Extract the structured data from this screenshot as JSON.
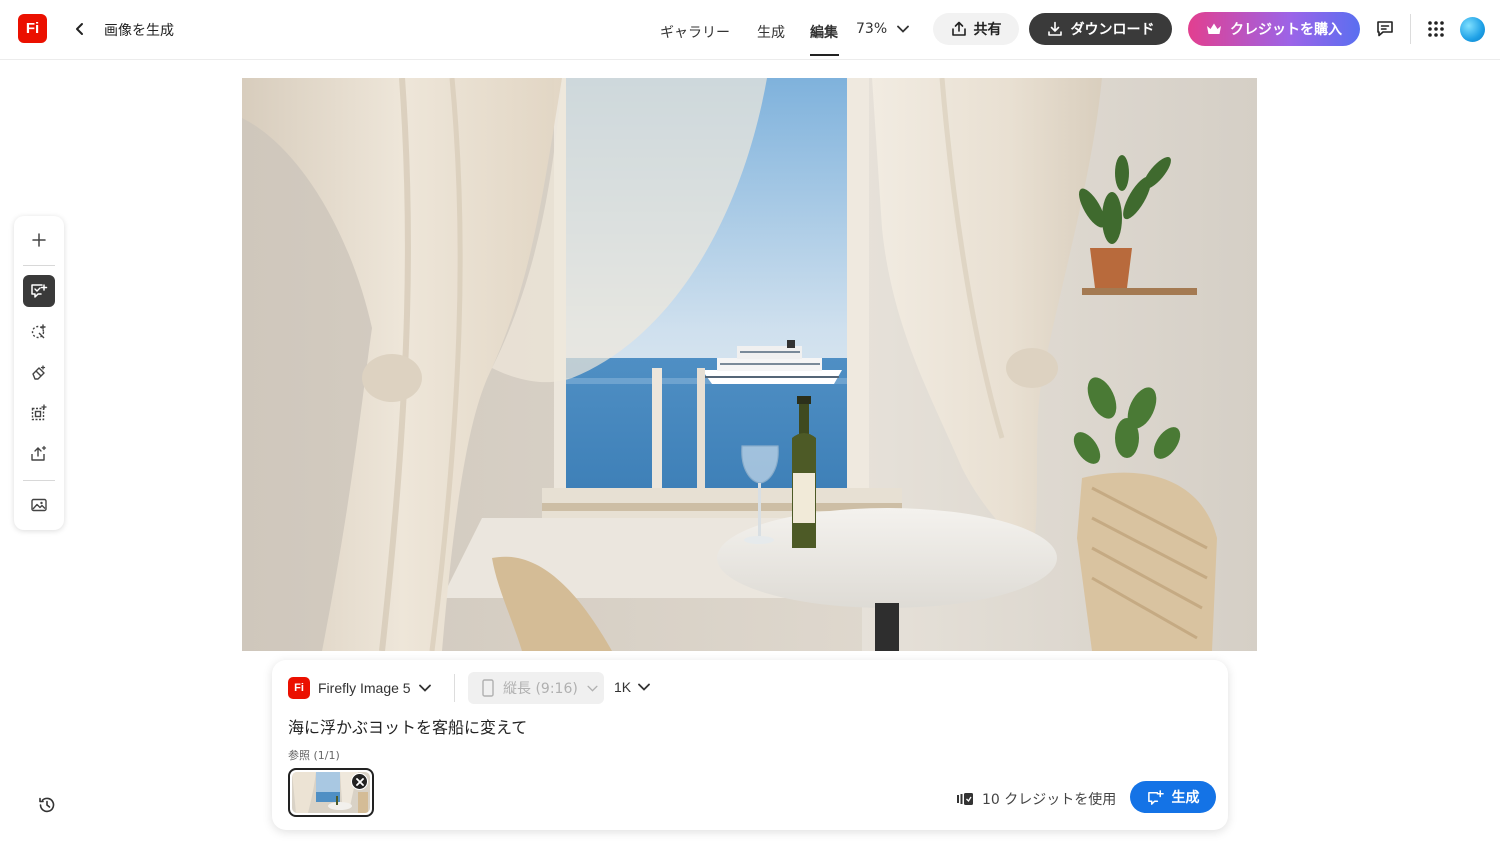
{
  "app": {
    "logo_text": "Fi",
    "title": "画像を生成"
  },
  "nav": {
    "gallery": "ギャラリー",
    "generate": "生成",
    "edit": "編集",
    "zoom": "73%"
  },
  "actions": {
    "share": "共有",
    "download": "ダウンロード",
    "buy_credits": "クレジットを購入"
  },
  "toolbar": {
    "tools": [
      "add-icon",
      "prompt-edit-icon",
      "select-icon",
      "erase-icon",
      "expand-icon",
      "upscale-icon",
      "image-icon"
    ],
    "active_tool": "prompt-edit-icon"
  },
  "panel": {
    "model_logo": "Fi",
    "model": "Firefly Image 5",
    "aspect_ratio": "縦長 (9:16)",
    "resolution": "1K",
    "prompt": "海に浮かぶヨットを客船に変えて",
    "reference_label": "参照 (1/1)",
    "credits_text": "10 クレジットを使用",
    "generate_label": "生成"
  },
  "colors": {
    "brand_red": "#eb1000",
    "primary_blue": "#1473e6",
    "dark_button": "#3a3a3a"
  }
}
